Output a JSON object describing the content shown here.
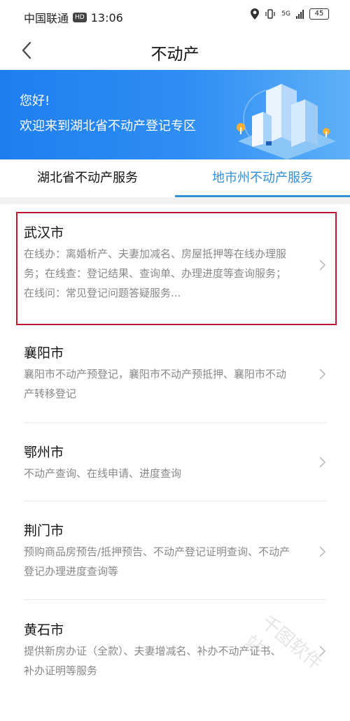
{
  "status_bar": {
    "carrier": "中国联通",
    "hd": "HD",
    "time": "13:06",
    "network": "5G",
    "battery": "45"
  },
  "nav": {
    "title": "不动产"
  },
  "banner": {
    "hello": "您好!",
    "welcome": "欢迎来到湖北省不动产登记专区"
  },
  "tabs": [
    {
      "label": "湖北省不动产服务",
      "active": false
    },
    {
      "label": "地市州不动产服务",
      "active": true
    }
  ],
  "cities": [
    {
      "name": "武汉市",
      "desc": [
        "在线办：离婚析产、夫妻加减名、房屋抵押等在线办理服",
        "务；在线查：登记结果、查询单、办理进度等查询服务；",
        "在线问：常见登记问题答疑服务..."
      ]
    },
    {
      "name": "襄阳市",
      "desc": [
        "襄阳市不动产预登记，襄阳市不动产预抵押、襄阳市不动",
        "产转移登记"
      ]
    },
    {
      "name": "鄂州市",
      "desc": [
        "不动产查询、在线申请、进度查询"
      ]
    },
    {
      "name": "荆门市",
      "desc": [
        "预购商品房预告/抵押预告、不动产登记证明查询、不动产",
        "登记办理进度查询等"
      ]
    },
    {
      "name": "黄石市",
      "desc": [
        "提供新房办证（全款）、夫妻增减名、补办不动产证书、",
        "补办证明等服务"
      ]
    }
  ],
  "watermark": "千图软件站",
  "colors": {
    "accent": "#2f8fd9",
    "banner": "#1e7ef0",
    "highlight": "#c0172d"
  }
}
